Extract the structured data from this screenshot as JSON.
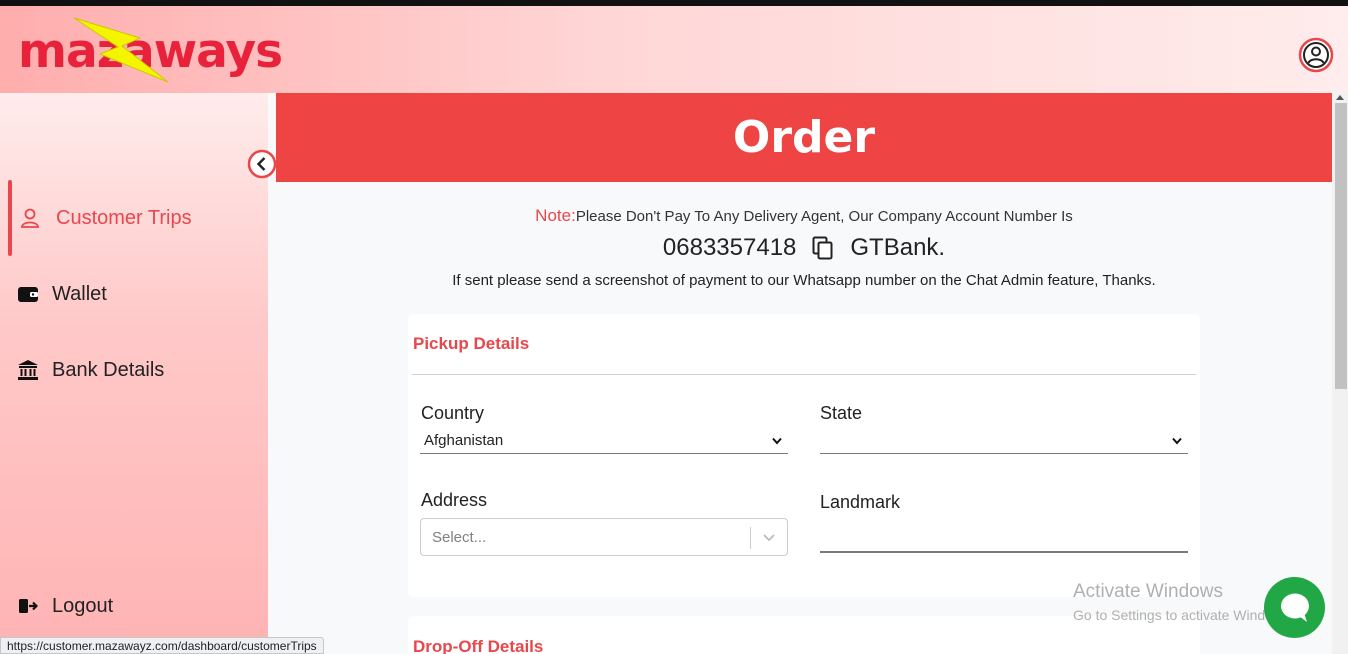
{
  "header": {
    "logo_text": "mazaways",
    "user_icon": "user-circle-icon",
    "brand_color": "#e8223a"
  },
  "sidebar": {
    "collapse_icon": "chevron-left-icon",
    "items": [
      {
        "label": "Customer Trips",
        "icon": "user-icon",
        "active": true
      },
      {
        "label": "Wallet",
        "icon": "wallet-icon",
        "active": false
      },
      {
        "label": "Bank Details",
        "icon": "bank-icon",
        "active": false
      }
    ],
    "logout_label": "Logout",
    "logout_icon": "logout-icon"
  },
  "page": {
    "title": "Order",
    "accent_color": "#ef4444",
    "note_tag": "Note:",
    "note_text": "Please Don't Pay To Any Delivery Agent, Our Company Account Number Is",
    "account_number": "0683357418",
    "bank_name": "GTBank.",
    "copy_icon": "copy-icon",
    "sent_note": "If sent please send a screenshot of payment to our Whatsapp number on the Chat Admin feature, Thanks."
  },
  "pickup": {
    "title": "Pickup Details",
    "country_label": "Country",
    "country_value": "Afghanistan",
    "state_label": "State",
    "state_value": "",
    "address_label": "Address",
    "address_placeholder": "Select...",
    "landmark_label": "Landmark",
    "landmark_value": ""
  },
  "dropoff": {
    "title": "Drop-Off Details"
  },
  "overlay": {
    "watermark_line1": "Activate Windows",
    "watermark_line2": "Go to Settings to activate Windows.",
    "chat_icon": "chat-bubble-icon",
    "chat_color": "#22a746",
    "status_url": "https://customer.mazawayz.com/dashboard/customerTrips"
  }
}
